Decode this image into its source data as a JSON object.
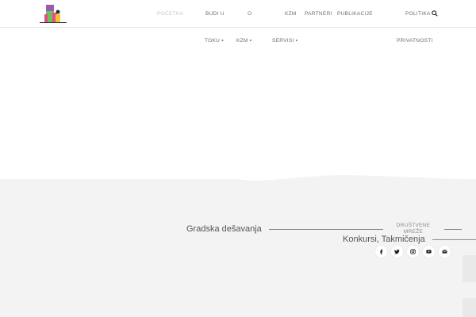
{
  "header": {
    "nav_top": [
      {
        "label": "POČETNA",
        "active": true
      },
      {
        "label": "BUDI U"
      },
      {
        "label": "O"
      },
      {
        "label": "KZM"
      },
      {
        "label": "PARTNERI"
      },
      {
        "label": "PUBLIKACIJE"
      },
      {
        "label": "POLITIKA"
      }
    ],
    "nav_bottom": [
      {
        "label": "TOKU"
      },
      {
        "label": "KZM"
      },
      {
        "label": "SERVISI"
      },
      {
        "label": "PRIVATNOSTI"
      }
    ],
    "search_icon": "search-icon"
  },
  "sections": {
    "events_title": "Gradska dešavanja",
    "contests_title": "Konkursi, Takmičenja"
  },
  "social": {
    "heading_line1": "DRUŠTVENE",
    "heading_line2": "MREŽE",
    "icons": [
      "facebook-icon",
      "twitter-icon",
      "instagram-icon",
      "youtube-icon",
      "email-icon"
    ]
  },
  "colors": {
    "accent_lines": "#8a8a8a",
    "background_band": "#f3f3f3"
  }
}
